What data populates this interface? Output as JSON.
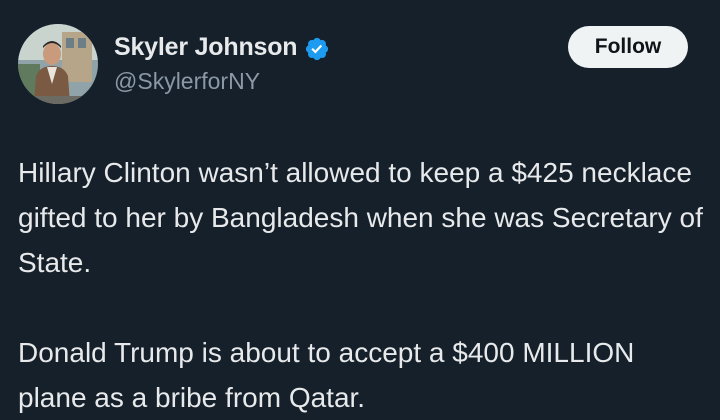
{
  "tweet": {
    "author": {
      "display_name": "Skyler Johnson",
      "handle": "@SkylerforNY",
      "verified": true,
      "avatar_icon": "profile-photo"
    },
    "follow_label": "Follow",
    "paragraphs": [
      "Hillary Clinton wasn’t allowed to keep a $425 necklace gifted to her by Bangladesh when she was Secretary of State.",
      "Donald Trump is about to accept a $400 MILLION plane as a bribe from Qatar."
    ]
  },
  "colors": {
    "background": "#15202b",
    "text_primary": "#e7e9ea",
    "text_secondary": "#8b98a5",
    "verified": "#1d9bf0",
    "follow_bg": "#eff3f4",
    "follow_text": "#0f1419"
  },
  "icons": {
    "verified": "verified-badge-icon"
  }
}
